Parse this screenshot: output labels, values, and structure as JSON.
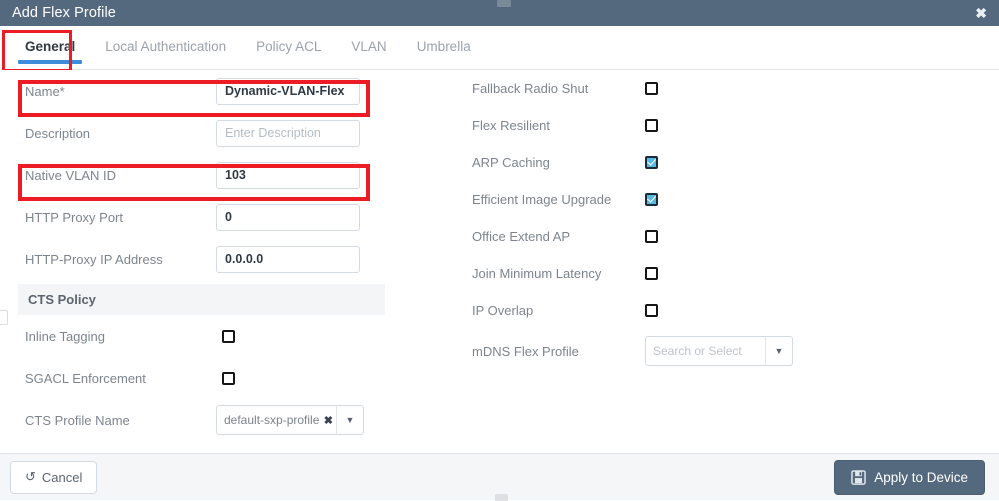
{
  "window": {
    "title": "Add Flex Profile",
    "close_icon": "close-icon",
    "close_label": "✖"
  },
  "tabs": [
    {
      "label": "General",
      "active": true
    },
    {
      "label": "Local Authentication",
      "active": false
    },
    {
      "label": "Policy ACL",
      "active": false
    },
    {
      "label": "VLAN",
      "active": false
    },
    {
      "label": "Umbrella",
      "active": false
    }
  ],
  "highlight_color": "#ed1c24",
  "accent_color": "#3c8ddc",
  "checkbox_checked_color": "#5ab9e0",
  "titlebar_color": "#54697d",
  "left_column": {
    "fields": [
      {
        "label": "Name*",
        "value": "Dynamic-VLAN-Flex",
        "placeholder": "",
        "is_placeholder": false,
        "highlighted": true
      },
      {
        "label": "Description",
        "value": "Enter Description",
        "placeholder": "Enter Description",
        "is_placeholder": true,
        "highlighted": false
      },
      {
        "label": "Native VLAN ID",
        "value": "103",
        "placeholder": "",
        "is_placeholder": false,
        "highlighted": true
      },
      {
        "label": "HTTP Proxy Port",
        "value": "0",
        "placeholder": "",
        "is_placeholder": false,
        "highlighted": false
      },
      {
        "label": "HTTP-Proxy IP Address",
        "value": "0.0.0.0",
        "placeholder": "",
        "is_placeholder": false,
        "highlighted": false
      }
    ],
    "section_title": "CTS Policy",
    "cts_rows": [
      {
        "label": "Inline Tagging",
        "type": "checkbox",
        "checked": false
      },
      {
        "label": "SGACL Enforcement",
        "type": "checkbox",
        "checked": false
      }
    ],
    "cts_profile": {
      "label": "CTS Profile Name",
      "value": "default-sxp-profile",
      "clear_icon": "clear-x-icon",
      "clear_label": "✖",
      "caret_icon": "chevron-down-icon",
      "caret_label": "▼"
    }
  },
  "right_column": {
    "checkboxes": [
      {
        "label": "Fallback Radio Shut",
        "checked": false
      },
      {
        "label": "Flex Resilient",
        "checked": false
      },
      {
        "label": "ARP Caching",
        "checked": true
      },
      {
        "label": "Efficient Image Upgrade",
        "checked": true
      },
      {
        "label": "Office Extend AP",
        "checked": false
      },
      {
        "label": "Join Minimum Latency",
        "checked": false
      },
      {
        "label": "IP Overlap",
        "checked": false
      }
    ],
    "mdns": {
      "label": "mDNS Flex Profile",
      "placeholder": "Search or Select",
      "caret_icon": "chevron-down-icon",
      "caret_label": "▼"
    }
  },
  "footer": {
    "cancel_label": "Cancel",
    "cancel_icon": "undo-icon",
    "cancel_icon_glyph": "↺",
    "apply_label": "Apply to Device",
    "apply_icon": "save-disk-icon"
  }
}
